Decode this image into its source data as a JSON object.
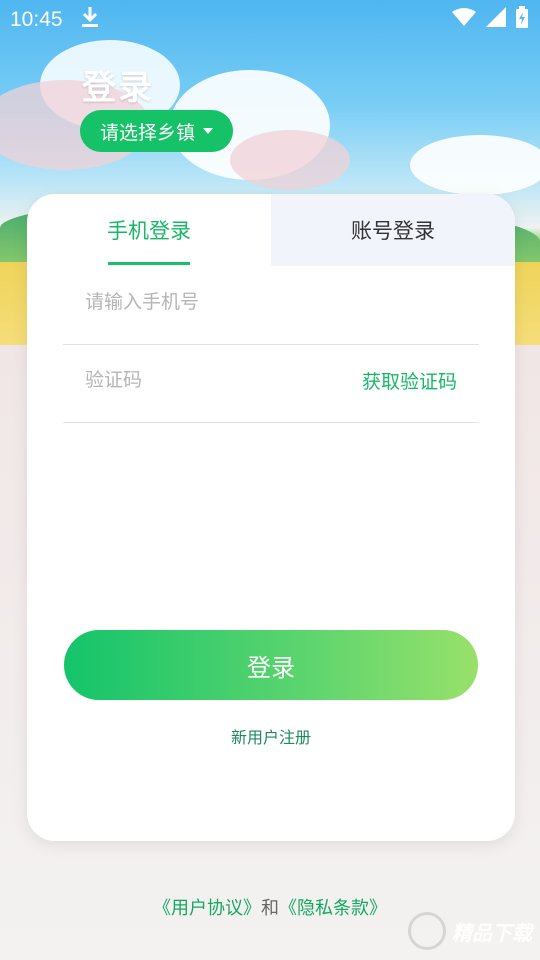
{
  "status_bar": {
    "time": "10:45",
    "download_icon": "download-icon",
    "wifi_icon": "wifi-icon",
    "signal_icon": "signal-icon",
    "battery_icon": "battery-icon"
  },
  "header": {
    "title": "登录",
    "town_selector": "请选择乡镇"
  },
  "tabs": [
    {
      "label": "手机登录",
      "active": true
    },
    {
      "label": "账号登录",
      "active": false
    }
  ],
  "form": {
    "phone_placeholder": "请输入手机号",
    "code_placeholder": "验证码",
    "get_code_label": "获取验证码"
  },
  "login_button": "登录",
  "register_link": "新用户注册",
  "agreement": {
    "user_agreement": "《用户协议》",
    "and": "和",
    "privacy_policy": "《隐私条款》"
  },
  "watermark": "精品下载",
  "colors": {
    "accent": "#16c267",
    "link": "#16a863"
  }
}
